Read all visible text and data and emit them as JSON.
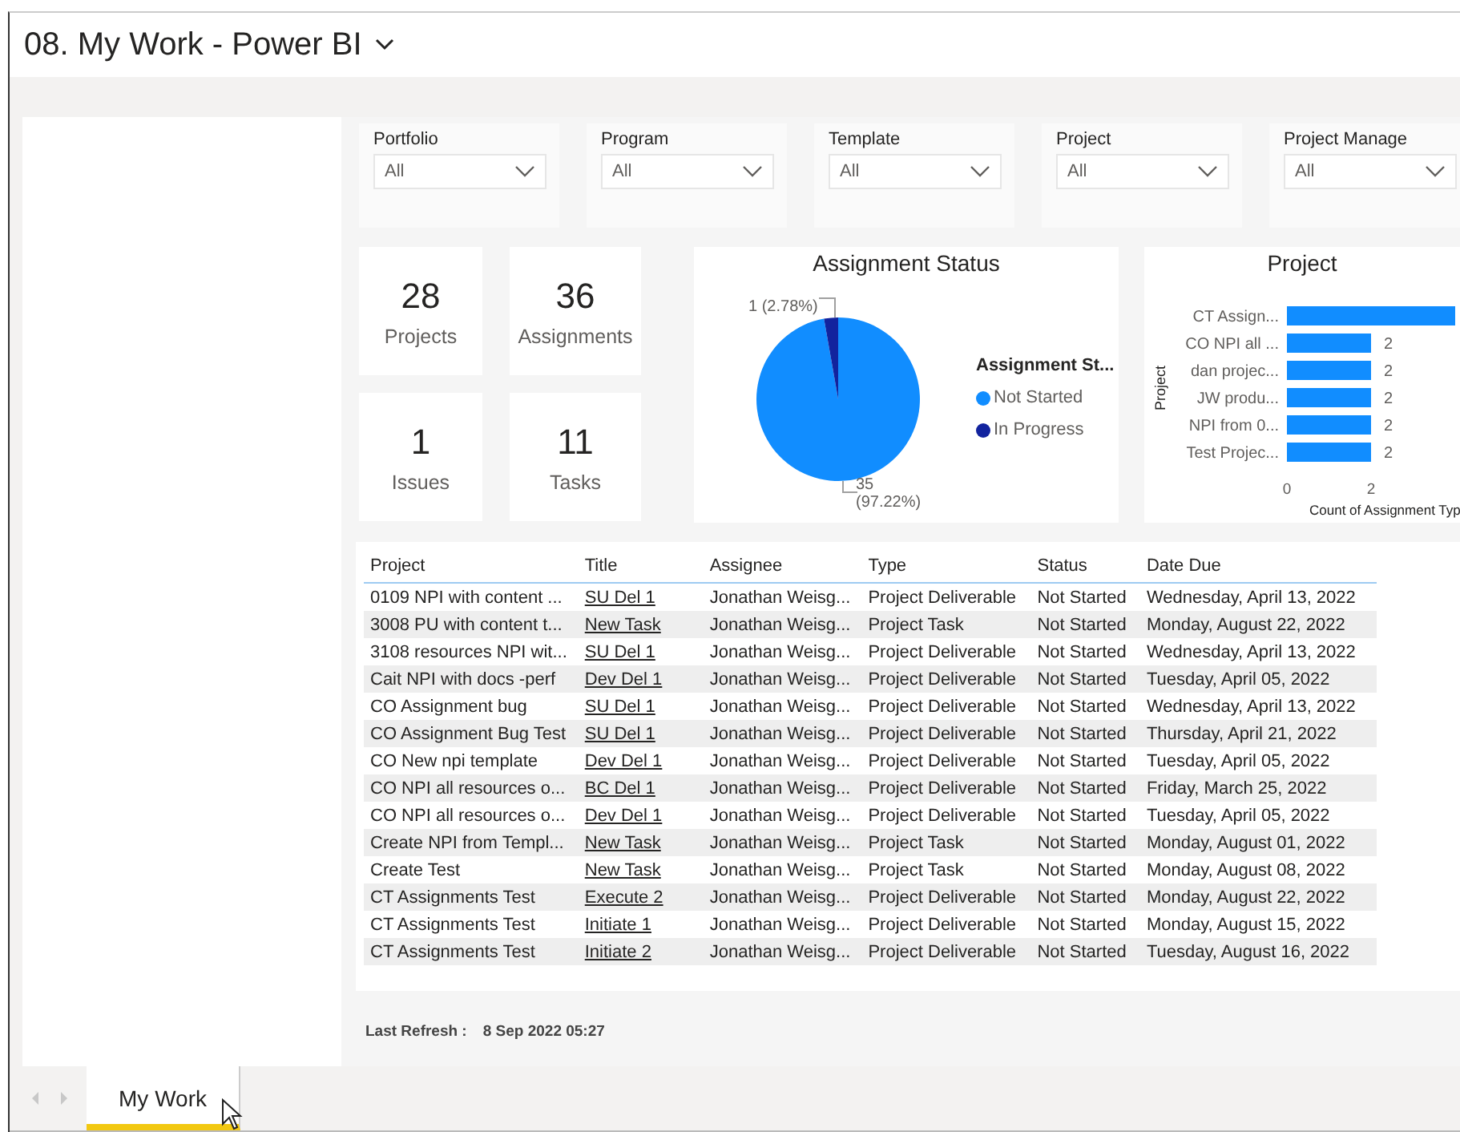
{
  "window": {
    "title": "08. My Work - Power BI"
  },
  "slicers": [
    {
      "label": "Portfolio",
      "value": "All"
    },
    {
      "label": "Program",
      "value": "All"
    },
    {
      "label": "Template",
      "value": "All"
    },
    {
      "label": "Project",
      "value": "All"
    },
    {
      "label": "Project Manage",
      "value": "All"
    }
  ],
  "cards": [
    {
      "value": "28",
      "label": "Projects"
    },
    {
      "value": "36",
      "label": "Assignments"
    },
    {
      "value": "1",
      "label": "Issues"
    },
    {
      "value": "11",
      "label": "Tasks"
    }
  ],
  "assignment_status": {
    "chart_data": {
      "type": "pie",
      "title": "Assignment Status",
      "legend": {
        "title": "Assignment St..."
      },
      "categories": [
        "Not Started",
        "In Progress"
      ],
      "values": [
        35,
        1
      ],
      "colors": [
        "#118dff",
        "#12239e"
      ],
      "value_labels": [
        "35 (97.22%)",
        "1 (2.78%)"
      ]
    }
  },
  "project_chart": {
    "chart_data": {
      "type": "bar",
      "orientation": "horizontal",
      "title": "Project",
      "ylabel": "Project",
      "xlabel": "Count of Assignment Typ",
      "categories": [
        "CT Assign...",
        "CO NPI all ...",
        "dan projec...",
        "JW produ...",
        "NPI from 0...",
        "Test Projec..."
      ],
      "series": [
        {
          "color": "#118dff",
          "values": [
            4,
            2,
            2,
            2,
            2,
            2
          ]
        }
      ],
      "value_labels": [
        null,
        "2",
        "2",
        "2",
        "2",
        "2"
      ],
      "xlim": [
        0,
        4
      ],
      "xticks": [
        0,
        2
      ]
    }
  },
  "table": {
    "columns": [
      "Project",
      "Title",
      "Assignee",
      "Type",
      "Status",
      "Date Due"
    ],
    "rows": [
      [
        "0109 NPI with content ...",
        "SU Del 1",
        "Jonathan Weisg...",
        "Project Deliverable",
        "Not Started",
        "Wednesday, April 13, 2022"
      ],
      [
        "3008 PU with content t...",
        "New Task",
        "Jonathan Weisg...",
        "Project Task",
        "Not Started",
        "Monday, August 22, 2022"
      ],
      [
        "3108 resources NPI wit...",
        "SU Del 1",
        "Jonathan Weisg...",
        "Project Deliverable",
        "Not Started",
        "Wednesday, April 13, 2022"
      ],
      [
        "Cait NPI with docs -perf",
        "Dev Del 1",
        "Jonathan Weisg...",
        "Project Deliverable",
        "Not Started",
        "Tuesday, April 05, 2022"
      ],
      [
        "CO Assignment bug",
        "SU Del 1",
        "Jonathan Weisg...",
        "Project Deliverable",
        "Not Started",
        "Wednesday, April 13, 2022"
      ],
      [
        "CO Assignment Bug Test",
        "SU Del 1",
        "Jonathan Weisg...",
        "Project Deliverable",
        "Not Started",
        "Thursday, April 21, 2022"
      ],
      [
        "CO New npi template",
        "Dev Del 1",
        "Jonathan Weisg...",
        "Project Deliverable",
        "Not Started",
        "Tuesday, April 05, 2022"
      ],
      [
        "CO NPI all resources o...",
        "BC Del 1",
        "Jonathan Weisg...",
        "Project Deliverable",
        "Not Started",
        "Friday, March 25, 2022"
      ],
      [
        "CO NPI all resources o...",
        "Dev Del 1",
        "Jonathan Weisg...",
        "Project Deliverable",
        "Not Started",
        "Tuesday, April 05, 2022"
      ],
      [
        "Create NPI from Templ...",
        "New Task",
        "Jonathan Weisg...",
        "Project Task",
        "Not Started",
        "Monday, August 01, 2022"
      ],
      [
        "Create Test",
        "New Task",
        "Jonathan Weisg...",
        "Project Task",
        "Not Started",
        "Monday, August 08, 2022"
      ],
      [
        "CT Assignments Test",
        "Execute 2",
        "Jonathan Weisg...",
        "Project Deliverable",
        "Not Started",
        "Monday, August 22, 2022"
      ],
      [
        "CT Assignments Test",
        "Initiate 1",
        "Jonathan Weisg...",
        "Project Deliverable",
        "Not Started",
        "Monday, August 15, 2022"
      ],
      [
        "CT Assignments Test",
        "Initiate 2",
        "Jonathan Weisg...",
        "Project Deliverable",
        "Not Started",
        "Tuesday, August 16, 2022"
      ]
    ]
  },
  "footer": {
    "label": "Last Refresh :",
    "value": "8 Sep 2022 05:27"
  },
  "tabs": [
    {
      "label": "My Work",
      "selected": true
    }
  ]
}
